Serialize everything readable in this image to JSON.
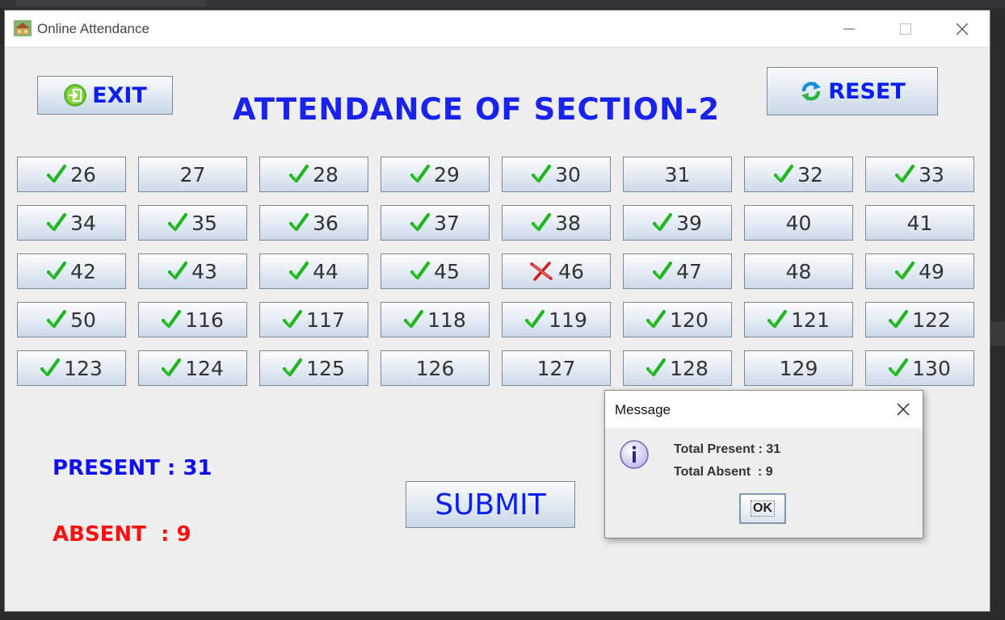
{
  "window": {
    "title": "Online Attendance"
  },
  "toolbar": {
    "exit_label": "EXIT",
    "reset_label": "RESET"
  },
  "heading": "ATTENDANCE OF SECTION-2",
  "roll_buttons": [
    {
      "roll": "26",
      "status": "present"
    },
    {
      "roll": "27",
      "status": "none"
    },
    {
      "roll": "28",
      "status": "present"
    },
    {
      "roll": "29",
      "status": "present"
    },
    {
      "roll": "30",
      "status": "present"
    },
    {
      "roll": "31",
      "status": "none"
    },
    {
      "roll": "32",
      "status": "present"
    },
    {
      "roll": "33",
      "status": "present"
    },
    {
      "roll": "34",
      "status": "present"
    },
    {
      "roll": "35",
      "status": "present"
    },
    {
      "roll": "36",
      "status": "present"
    },
    {
      "roll": "37",
      "status": "present"
    },
    {
      "roll": "38",
      "status": "present"
    },
    {
      "roll": "39",
      "status": "present"
    },
    {
      "roll": "40",
      "status": "none"
    },
    {
      "roll": "41",
      "status": "none"
    },
    {
      "roll": "42",
      "status": "present"
    },
    {
      "roll": "43",
      "status": "present"
    },
    {
      "roll": "44",
      "status": "present"
    },
    {
      "roll": "45",
      "status": "present"
    },
    {
      "roll": "46",
      "status": "absent"
    },
    {
      "roll": "47",
      "status": "present"
    },
    {
      "roll": "48",
      "status": "none"
    },
    {
      "roll": "49",
      "status": "present"
    },
    {
      "roll": "50",
      "status": "present"
    },
    {
      "roll": "116",
      "status": "present"
    },
    {
      "roll": "117",
      "status": "present"
    },
    {
      "roll": "118",
      "status": "present"
    },
    {
      "roll": "119",
      "status": "present"
    },
    {
      "roll": "120",
      "status": "present"
    },
    {
      "roll": "121",
      "status": "present"
    },
    {
      "roll": "122",
      "status": "present"
    },
    {
      "roll": "123",
      "status": "present"
    },
    {
      "roll": "124",
      "status": "present"
    },
    {
      "roll": "125",
      "status": "present"
    },
    {
      "roll": "126",
      "status": "none"
    },
    {
      "roll": "127",
      "status": "none"
    },
    {
      "roll": "128",
      "status": "present"
    },
    {
      "roll": "129",
      "status": "none"
    },
    {
      "roll": "130",
      "status": "present"
    }
  ],
  "summary": {
    "present_text": "PRESENT : 31",
    "absent_text": "ABSENT  : 9"
  },
  "submit_label": "SUBMIT",
  "dialog": {
    "title": "Message",
    "line1": "Total Present : 31",
    "line2": "Total Absent  : 9",
    "ok_label": "OK"
  },
  "icons": {
    "exit": "exit-door-icon",
    "reset": "refresh-icon",
    "present": "check-mark-icon",
    "absent": "cross-mark-icon",
    "info": "info-icon"
  },
  "colors": {
    "heading": "#1a22ee",
    "present": "#1010ee",
    "absent": "#ff1010",
    "check": "#22b522",
    "cross": "#d02020"
  }
}
